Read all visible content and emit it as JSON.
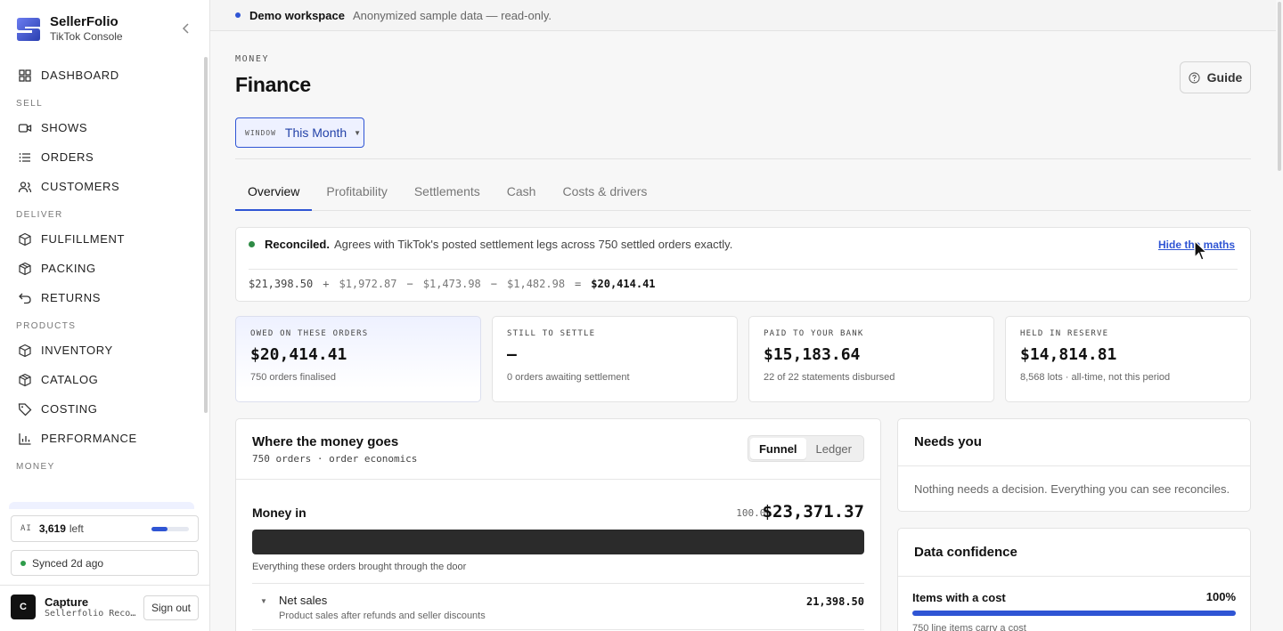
{
  "app": {
    "name": "SellerFolio",
    "subtitle": "TikTok Console"
  },
  "sidebar": {
    "sections": [
      {
        "items": [
          {
            "label": "DASHBOARD",
            "icon": "grid-icon"
          }
        ]
      },
      {
        "title": "SELL",
        "items": [
          {
            "label": "SHOWS",
            "icon": "video-icon"
          },
          {
            "label": "ORDERS",
            "icon": "list-icon"
          },
          {
            "label": "CUSTOMERS",
            "icon": "users-icon"
          }
        ]
      },
      {
        "title": "DELIVER",
        "items": [
          {
            "label": "FULFILLMENT",
            "icon": "box-icon"
          },
          {
            "label": "PACKING",
            "icon": "package-icon"
          },
          {
            "label": "RETURNS",
            "icon": "return-arrow-icon"
          }
        ]
      },
      {
        "title": "PRODUCTS",
        "items": [
          {
            "label": "INVENTORY",
            "icon": "box-icon"
          },
          {
            "label": "CATALOG",
            "icon": "package-icon"
          },
          {
            "label": "COSTING",
            "icon": "tag-icon"
          },
          {
            "label": "PERFORMANCE",
            "icon": "bar-chart-icon"
          }
        ]
      },
      {
        "title": "MONEY",
        "items": []
      }
    ],
    "ai": {
      "tag": "AI",
      "count": "3,619",
      "suffix": "left",
      "usage_fraction": 0.42
    },
    "sync": {
      "text": "Synced 2d ago"
    },
    "user": {
      "initial": "C",
      "name": "Capture",
      "sub": "Sellerfolio Recording"
    },
    "signout_label": "Sign out"
  },
  "banner": {
    "title": "Demo workspace",
    "subtitle": "Anonymized sample data — read-only."
  },
  "page": {
    "eyebrow": "MONEY",
    "title": "Finance",
    "guide_label": "Guide",
    "window": {
      "tag": "WINDOW",
      "value": "This Month"
    },
    "tabs": [
      "Overview",
      "Profitability",
      "Settlements",
      "Cash",
      "Costs & drivers"
    ],
    "active_tab": "Overview"
  },
  "reconciliation": {
    "status": "Reconciled.",
    "text": "Agrees with TikTok's posted settlement legs across 750 settled orders exactly.",
    "toggle_label": "Hide the maths",
    "equation": [
      "$21,398.50",
      "+",
      "$1,972.87",
      "−",
      "$1,473.98",
      "−",
      "$1,482.98",
      "=",
      "$20,414.41"
    ]
  },
  "kpis": [
    {
      "label": "OWED ON THESE ORDERS",
      "value": "$20,414.41",
      "sub": "750 orders finalised"
    },
    {
      "label": "STILL TO SETTLE",
      "value": "—",
      "sub": "0 orders awaiting settlement"
    },
    {
      "label": "PAID TO YOUR BANK",
      "value": "$15,183.64",
      "sub": "22 of 22 statements disbursed"
    },
    {
      "label": "HELD IN RESERVE",
      "value": "$14,814.81",
      "sub": "8,568 lots · all-time, not this period"
    }
  ],
  "money_flow": {
    "title": "Where the money goes",
    "subtitle": "750 orders · order economics",
    "views": [
      "Funnel",
      "Ledger"
    ],
    "active_view": "Funnel",
    "money_in": {
      "label": "Money in",
      "pct": "100.0%",
      "amount": "$23,371.37",
      "note": "Everything these orders brought through the door",
      "fill_fraction": 1.0
    },
    "rows": [
      {
        "label": "Net sales",
        "sub": "Product sales after refunds and seller discounts",
        "amount": "21,398.50"
      }
    ]
  },
  "needs_you": {
    "title": "Needs you",
    "text": "Nothing needs a decision. Everything you can see reconciles."
  },
  "data_confidence": {
    "title": "Data confidence",
    "metrics": [
      {
        "label": "Items with a cost",
        "pct": "100%",
        "fraction": 1.0,
        "sub": "750 line items carry a cost"
      }
    ]
  },
  "colors": {
    "accent": "#2f55d4",
    "success": "#2e8b45",
    "bar_dark": "#2b2b2b"
  }
}
